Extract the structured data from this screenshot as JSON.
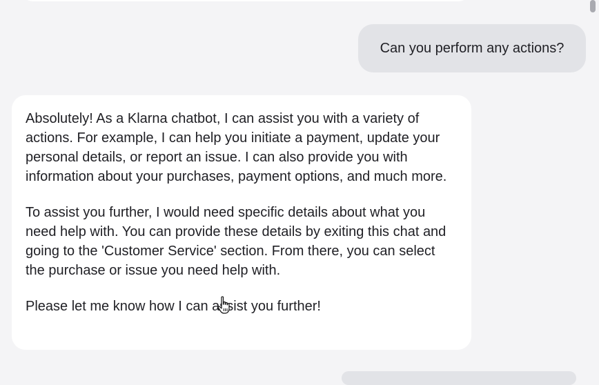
{
  "chat": {
    "user_message": "Can you perform any actions?",
    "bot_reply": {
      "paragraph_1": "Absolutely! As a Klarna chatbot, I can assist you with a variety of actions. For example, I can help you initiate a payment, update your personal details, or report an issue. I can also provide you with information about your purchases, payment options, and much more.",
      "paragraph_2": "To assist you further, I would need specific details about what you need help with. You can provide these details by exiting this chat and going to the 'Customer Service' section. From there, you can select the purchase or issue you need help with.",
      "paragraph_3": "Please let me know how I can assist you further!"
    }
  },
  "colors": {
    "background": "#f4f4f6",
    "user_bubble": "#e2e3e7",
    "bot_bubble": "#ffffff",
    "text": "#1f1f24"
  },
  "icons": {
    "cursor": "hand-pointer-icon"
  }
}
